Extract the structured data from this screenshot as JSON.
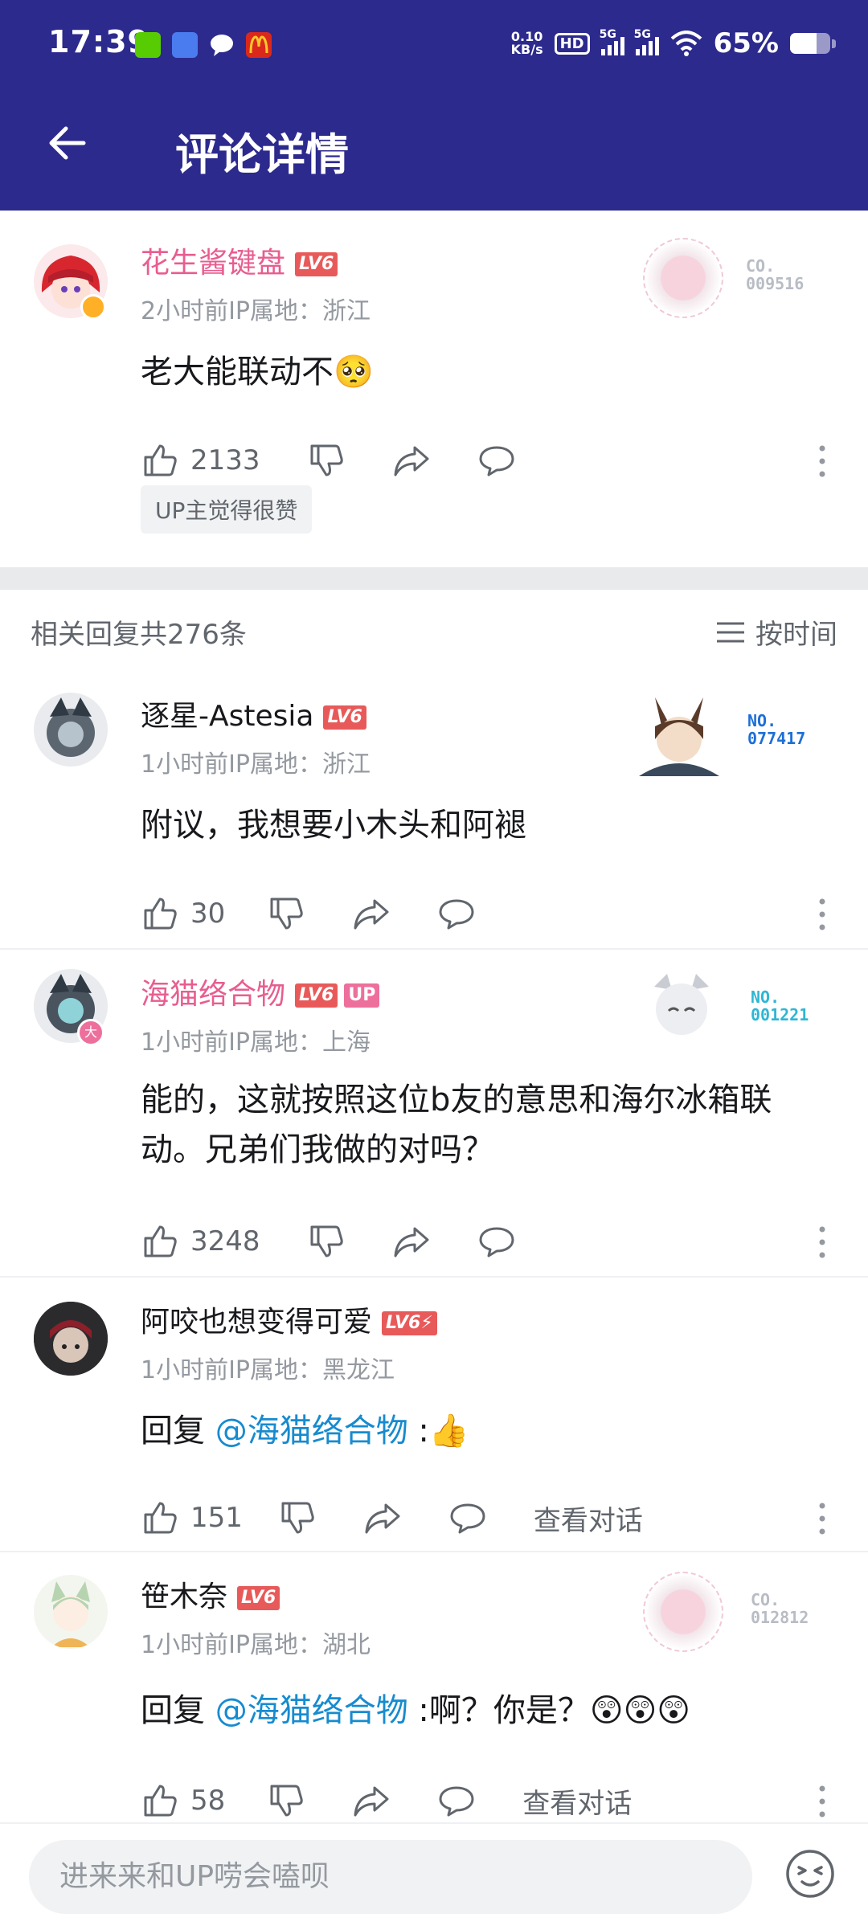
{
  "status_bar": {
    "time": "17:39",
    "net_speed_top": "0.10",
    "net_speed_unit": "KB/s",
    "hd": "HD",
    "sim1": "5G",
    "sim2": "5G",
    "battery_pct": "65%",
    "battery_level": 0.65,
    "app_icons": [
      "duolingo-icon",
      "reader-icon",
      "chat-icon",
      "mcdonalds-icon"
    ]
  },
  "header": {
    "title": "评论详情",
    "back_icon": "back-arrow-icon"
  },
  "main_comment": {
    "username": "花生酱键盘",
    "level": "LV6",
    "meta": "2小时前IP属地：浙江",
    "text": "老大能联动不🥺",
    "likes": "2133",
    "fan_no": "CO.\n009516",
    "up_liked": "UP主觉得很赞"
  },
  "replies_header": {
    "count_text": "相关回复共276条",
    "sort_label": "按时间"
  },
  "replies": [
    {
      "username": "逐星-Astesia",
      "level": "LV6",
      "meta": "1小时前IP属地：浙江",
      "text": "附议，我想要小木头和阿褪",
      "likes": "30",
      "fan_no": "NO.\n077417"
    },
    {
      "username": "海猫络合物",
      "level": "LV6",
      "up_badge": "UP",
      "meta": "1小时前IP属地：上海",
      "text": "能的，这就按照这位b友的意思和海尔冰箱联动。兄弟们我做的对吗？",
      "likes": "3248",
      "fan_no": "NO.\n001221"
    },
    {
      "username": "阿咬也想变得可爱",
      "level": "LV6⚡",
      "meta": "1小时前IP属地：黑龙江",
      "reply_prefix": "回复 ",
      "mention": "@海猫络合物",
      "text_after": " :👍",
      "likes": "151",
      "view_conversation": "查看对话"
    },
    {
      "username": "笹木奈",
      "level": "LV6",
      "meta": "1小时前IP属地：湖北",
      "reply_prefix": "回复 ",
      "mention": "@海猫络合物",
      "text_after": " :啊？你是？😲😲😲",
      "likes": "58",
      "view_conversation": "查看对话",
      "fan_no": "CO.\n012812"
    }
  ],
  "input": {
    "placeholder": "进来来和UP唠会嗑呗"
  },
  "colors": {
    "header_bg": "#2c2a8d",
    "vip_name": "#e85d8f",
    "mention": "#178bcf",
    "level_badge": "#e85a5a"
  }
}
